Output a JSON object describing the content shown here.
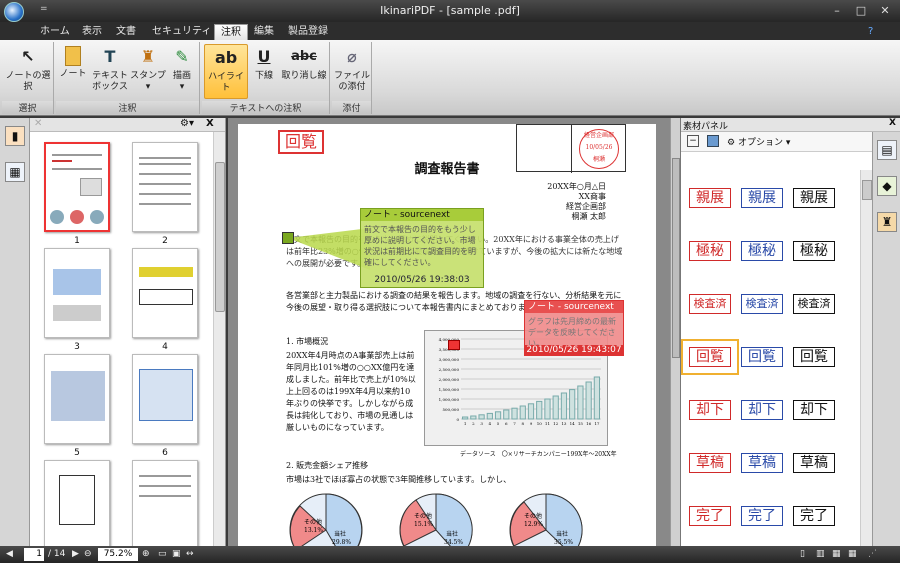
{
  "window": {
    "title": "IkinariPDF - [sample .pdf]",
    "qat": "=",
    "min": "–",
    "max": "□",
    "close": "✕"
  },
  "tabs": [
    {
      "label": "ホーム"
    },
    {
      "label": "表示"
    },
    {
      "label": "文書"
    },
    {
      "label": "セキュリティ"
    },
    {
      "label": "注釈"
    },
    {
      "label": "編集"
    },
    {
      "label": "製品登録"
    }
  ],
  "ribbon": {
    "groups": {
      "select": "選択",
      "annot": "注釈",
      "text_annot": "テキストへの注釈",
      "attach": "添付"
    },
    "buttons": {
      "select": "ノートの選択",
      "note": "ノート",
      "textbox1": "テキスト",
      "textbox2": "ボックス",
      "stamp": "スタンプ",
      "draw": "描画",
      "highlight": "ハイライト",
      "underline": "下線",
      "strike": "取り消し線",
      "attach1": "ファイル",
      "attach2": "の添付",
      "hl_icon": "ab",
      "ul_icon": "U",
      "st_icon": "abc"
    }
  },
  "thumbs": {
    "pages": [
      "1",
      "2",
      "3",
      "4",
      "5",
      "6"
    ],
    "gear": "⚙▾",
    "close": "X"
  },
  "doc": {
    "stamp_main": "回覧",
    "title": "調査報告書",
    "date": "20XX年○月△日",
    "company": "XX商事",
    "dept": "経営企画部",
    "author": "桐瀬 太郎",
    "circle_stamp": "経営企画部",
    "circle_date": "10/05/26",
    "circle_name": "桐瀬",
    "para1": "前文で本報告の目的をもう少し厚めに説明してください。20XX年における事業全体の売上げは前年比23%増の○億ドルで、過去最高と成長を続けていますが、今後の拡大には新たな地域への展開が必要です。",
    "para2": "各営業部と主力製品における調査の結果を報告します。地域の調査を行ない、分析結果を元に今後の展望・取り得る選択肢について本報告書内にまとめております。",
    "sec1": "1. 市場概況",
    "sec1_text": "20XX年4月時点のA事業部売上は前年同月比101%増の○○XX億円を達成しました。前年比で売上が10%以上上回るのは199X年4月以来約10年ぶりの快挙です。しかしながら成長は鈍化しており、市場の見通しは厳しいものになっています。",
    "chart_source": "データソース　〇×リサーチカンパニー199X年〜20XX年",
    "sec2": "2. 販売金額シェア推移",
    "sec2_text": "市場は3社でほぼ寡占の状態で3年間推移しています。しかし、",
    "pie_labels": {
      "other1": "その他",
      "other1v": "15.1%",
      "ours1": "当社",
      "ours1v": "29.8%",
      "other2": "その他",
      "other2v": "15.1%",
      "ours2": "当社",
      "ours2v": "34.5%",
      "other3": "その他",
      "other3v": "12.9%",
      "ours3": "当社",
      "ours3v": "35.5%",
      "other0": "その他",
      "other0v": "13.1%"
    }
  },
  "chart_data": {
    "type": "bar",
    "title": "",
    "categories": [
      "1",
      "2",
      "3",
      "4",
      "5",
      "6",
      "7",
      "8",
      "9",
      "10",
      "11",
      "12",
      "13",
      "14",
      "15",
      "16",
      "17"
    ],
    "values": [
      100,
      150,
      210,
      280,
      360,
      450,
      540,
      650,
      760,
      880,
      1000,
      1150,
      1300,
      1470,
      1650,
      1850,
      2100
    ],
    "ylim": [
      0,
      4000
    ],
    "yticks": [
      "4,000,000",
      "3,500,000",
      "3,000,000",
      "2,500,000",
      "2,000,000",
      "1,500,000",
      "1,000,000",
      "500,000",
      "0"
    ]
  },
  "notes": [
    {
      "author": "ノート - sourcenext",
      "body": "前文で本報告の目的をもう少し厚めに説明してください。市場状況は前期比にて調査目的を明確にしてください。",
      "time": "2010/05/26 19:38:03"
    },
    {
      "author": "ノート - sourcenext",
      "body": "グラフは先月締めの最新データを反映してください。",
      "time": "2010/05/26 19:43:07"
    }
  ],
  "assets": {
    "title": "素材パネル",
    "options": "オプション",
    "close": "X",
    "rows": [
      [
        "親展",
        "親展",
        "親展"
      ],
      [
        "極秘",
        "極秘",
        "極秘"
      ],
      [
        "検査済",
        "検査済",
        "検査済"
      ],
      [
        "回覧",
        "回覧",
        "回覧"
      ],
      [
        "却下",
        "却下",
        "却下"
      ],
      [
        "草稿",
        "草稿",
        "草稿"
      ],
      [
        "完了",
        "完了",
        "完了"
      ]
    ],
    "colors": [
      "#d02a2a",
      "#2a4aa8",
      "#111111"
    ]
  },
  "status": {
    "page": "1",
    "total": "/ 14",
    "zoom": "75.2%"
  }
}
